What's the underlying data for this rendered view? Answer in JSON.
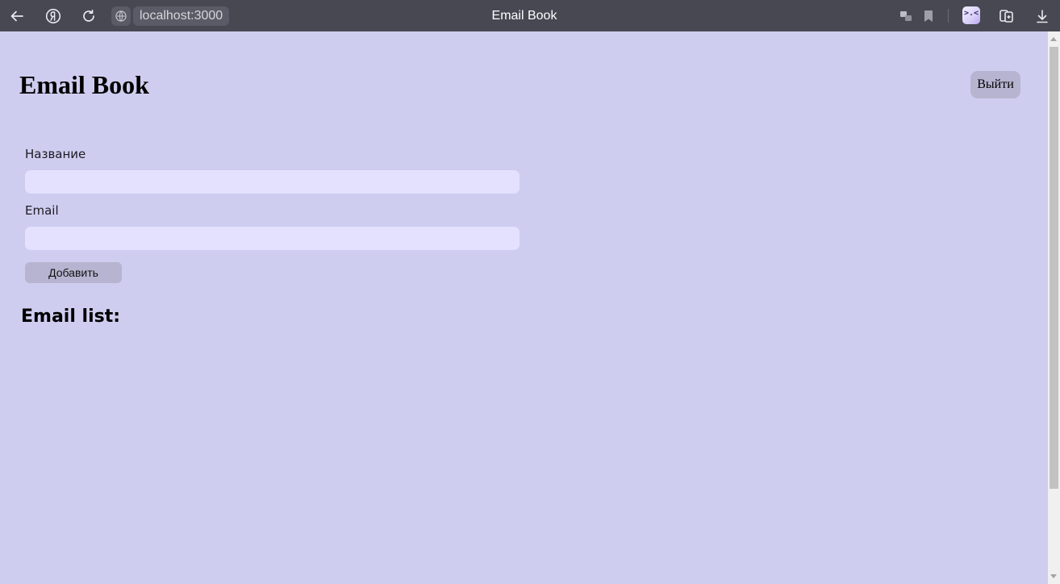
{
  "browser": {
    "tab_title": "Email Book",
    "url": "localhost:3000",
    "icons": {
      "back": "back-arrow-icon",
      "yandex": "yandex-logo-icon",
      "reload": "reload-icon",
      "site": "site-globe-icon",
      "translate": "translate-icon",
      "bookmark": "bookmark-icon",
      "extension": "extension-icon",
      "collections": "collections-icon",
      "download": "download-icon"
    },
    "extension_glyph": ">.<"
  },
  "header": {
    "title": "Email Book",
    "logout_label": "Выйти"
  },
  "form": {
    "name_label": "Название",
    "name_value": "",
    "email_label": "Email",
    "email_value": "",
    "submit_label": "Добавить"
  },
  "list": {
    "title": "Email list:",
    "items": []
  },
  "colors": {
    "page_background": "#cfcdef",
    "input_background": "#e3e1fe",
    "button_background": "#b6b4d0",
    "browser_bar": "#474852"
  }
}
